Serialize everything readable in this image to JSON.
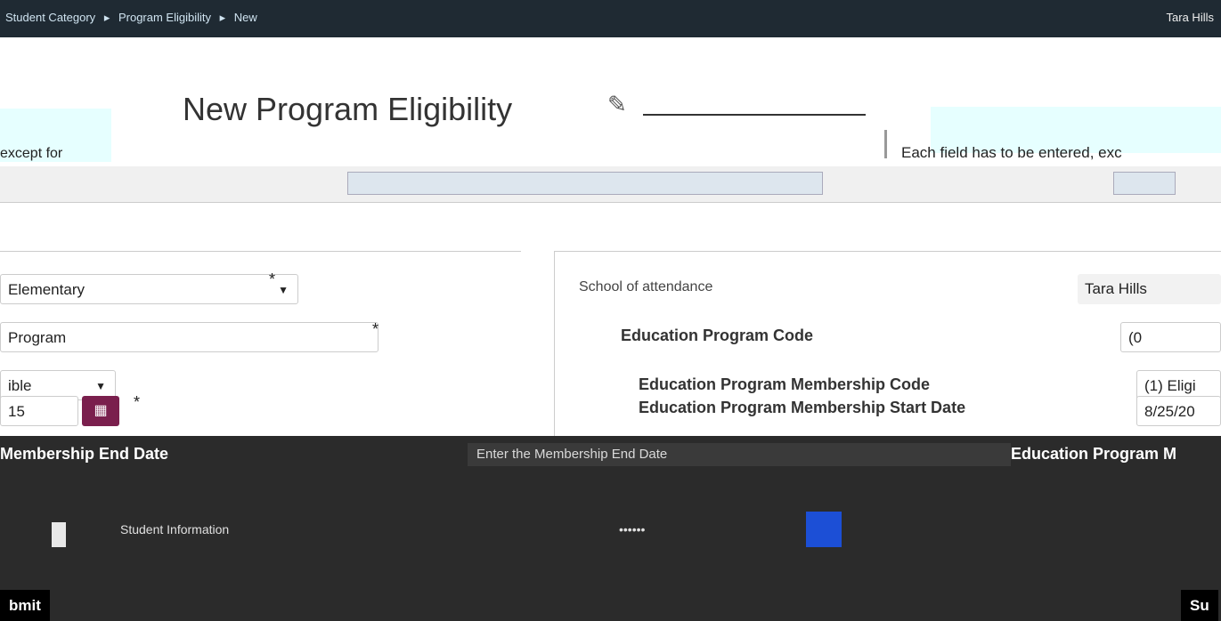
{
  "topbar": {
    "breadcrumb": [
      "Student Category",
      "Program Eligibility",
      "New"
    ],
    "right_text": "Tara Hills"
  },
  "page": {
    "title": "New Program Eligibility",
    "except_text": "except for",
    "notice_text": "Each field has to be entered, exc"
  },
  "left_form": {
    "school_value": "Elementary",
    "program_value": "Program",
    "eligibility_value": "ible",
    "start_date_value": "15"
  },
  "right_form": {
    "school_label": "School of attendance",
    "school_value": "Tara Hills",
    "program_code_label": "Education Program Code",
    "program_code_value": "(0",
    "membership_code_label": "Education Program Membership Code",
    "membership_code_value": "(1) Eligi",
    "membership_start_label": "Education Program Membership Start Date",
    "membership_start_value": "8/25/20"
  },
  "bottom": {
    "membership_end_label": "Membership End Date",
    "edu_program_label": "Education Program M",
    "highlight_text": "Enter the Membership End Date",
    "student_info": "Student Information",
    "masked": "••••••",
    "submit_left": "bmit",
    "submit_right": "Su"
  },
  "colors": {
    "calendar_button": "#7a1f4d",
    "accent_blue": "#1c4fd6"
  }
}
